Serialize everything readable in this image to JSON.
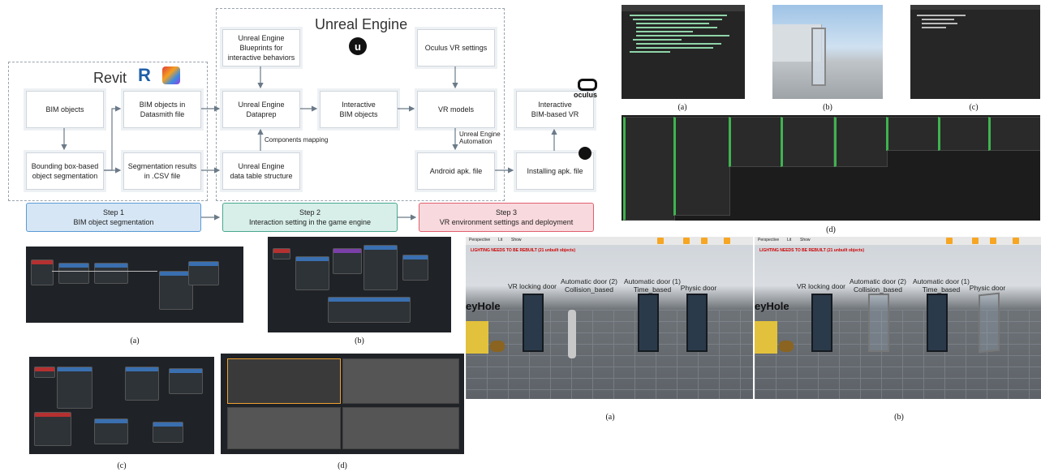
{
  "diagram": {
    "unreal_title": "Unreal Engine",
    "revit_title": "Revit",
    "nodes": {
      "bim_objects": "BIM objects",
      "bim_datasmith": "BIM objects in\nDatasmith file",
      "ue_blueprints": "Unreal Engine\nBlueprints for\ninteractive behaviors",
      "ue_dataprep": "Unreal Engine\nDataprep",
      "interactive_bim": "Interactive\nBIM objects",
      "oculus_settings": "Oculus VR settings",
      "vr_models": "VR models",
      "interactive_vr": "Interactive\nBIM-based VR",
      "bbox_seg": "Bounding box-based\nobject segmentation",
      "seg_results": "Segmentation results\nin .CSV file",
      "ue_table": "Unreal Engine\ndata table structure",
      "android_apk": "Android apk. file",
      "installing_apk": "Installing apk. file"
    },
    "edge_labels": {
      "components_mapping": "Components mapping",
      "ue_automation": "Unreal Engine\nAutomation"
    },
    "oculus_logo_text": "oculus",
    "steps": [
      {
        "title": "Step 1",
        "desc": "BIM object segmentation"
      },
      {
        "title": "Step 2",
        "desc": "Interaction setting in the game engine"
      },
      {
        "title": "Step 3",
        "desc": "VR environment settings and deployment"
      }
    ]
  },
  "captions": {
    "top_right_a": "(a)",
    "top_right_b": "(b)",
    "top_right_c": "(c)",
    "top_right_d": "(d)",
    "bp_a": "(a)",
    "bp_b": "(b)",
    "bp_c": "(c)",
    "bp_d": "(d)",
    "vr_a": "(a)",
    "vr_b": "(b)"
  },
  "vr_scene": {
    "warning": "LIGHTING NEEDS TO BE REBUILT (21 unbuilt objects)",
    "perspective": "Perspective",
    "lit": "Lit",
    "show": "Show",
    "keyhole": "eyHole",
    "labels": {
      "vr_locking": "VR locking door",
      "auto2": "Automatic door (2)\nCollision_based",
      "auto1": "Automatic door (1)\nTime_based",
      "physic": "Physic door"
    }
  },
  "colors": {
    "step1_bg": "#d6e6f5",
    "step1_border": "#5b9bd5",
    "step2_bg": "#d8efe9",
    "step2_border": "#49a88f",
    "step3_bg": "#f8d9dd",
    "step3_border": "#e0606e",
    "arrow": "#6b7a88"
  }
}
